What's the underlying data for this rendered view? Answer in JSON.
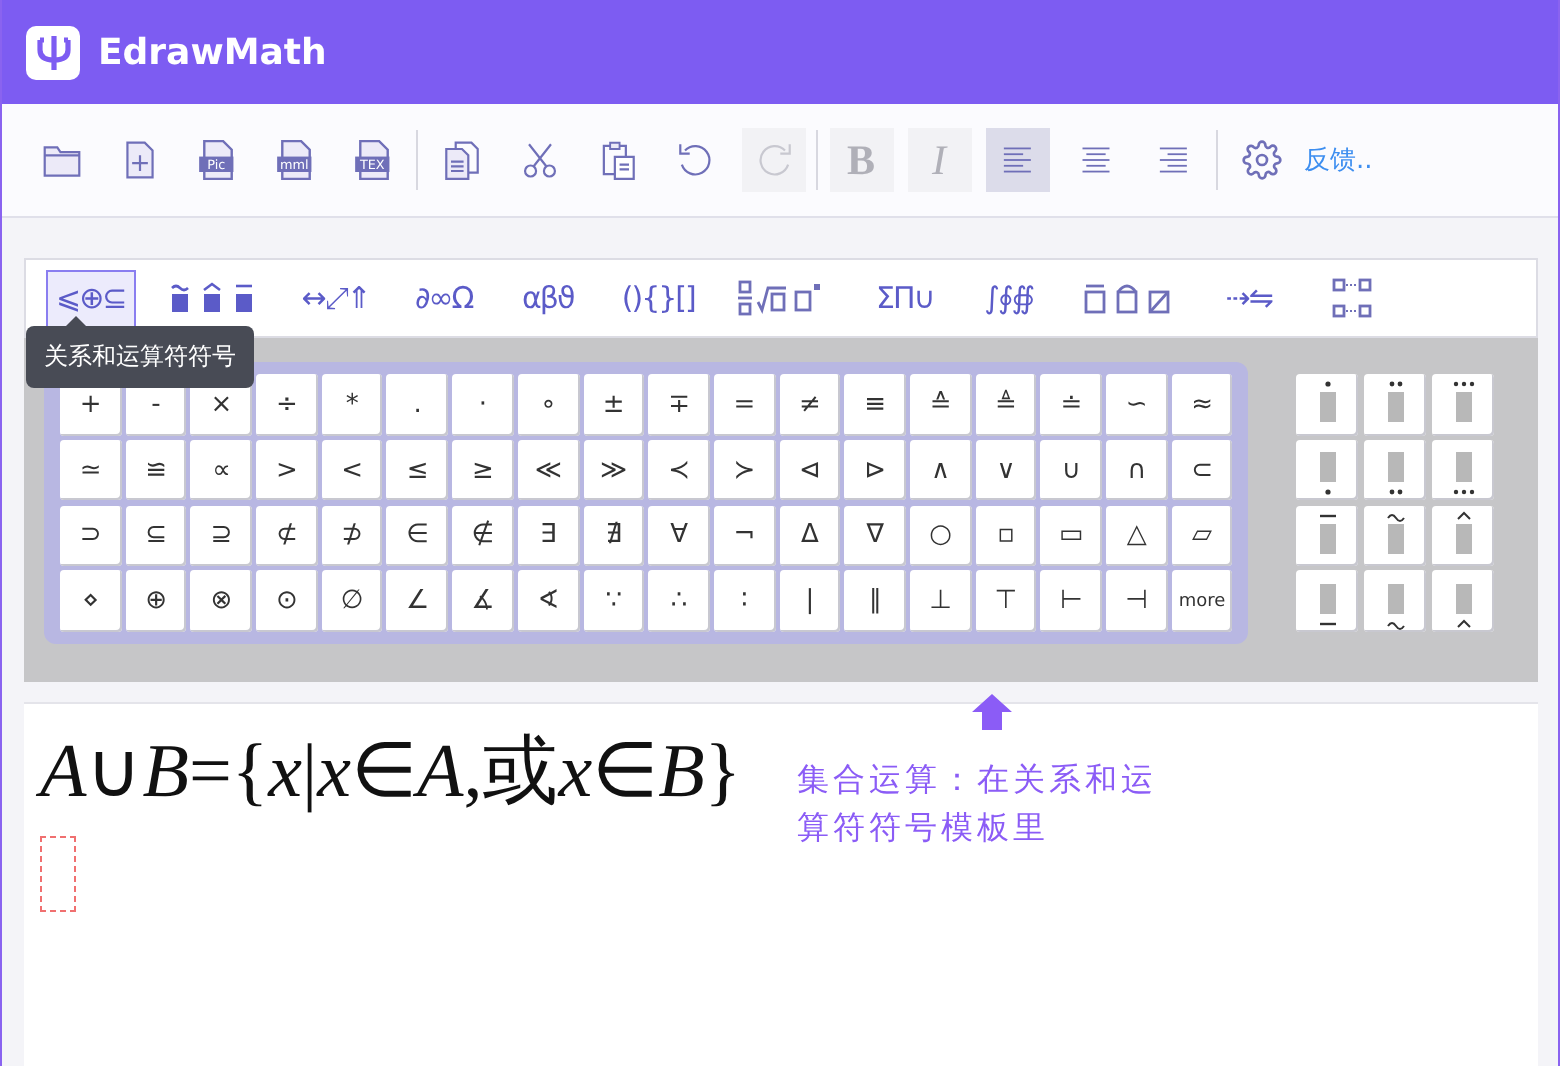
{
  "app": {
    "title": "EdrawMath"
  },
  "toolbar": {
    "file_icons": [
      {
        "kind": "open"
      },
      {
        "kind": "new"
      },
      {
        "kind": "file",
        "label": "Pic"
      },
      {
        "kind": "file",
        "label": "mml"
      },
      {
        "kind": "file",
        "label": "TEX"
      }
    ],
    "edit_icons": [
      {
        "kind": "copy",
        "disabled": false
      },
      {
        "kind": "cut",
        "disabled": false
      },
      {
        "kind": "paste",
        "disabled": false
      },
      {
        "kind": "undo",
        "disabled": false
      },
      {
        "kind": "redo",
        "disabled": true
      }
    ],
    "format_buttons": [
      {
        "label": "B",
        "kind": "bold",
        "disabled": true
      },
      {
        "label": "I",
        "kind": "italic",
        "disabled": true
      }
    ],
    "align_buttons": [
      {
        "kind": "left",
        "selected": true
      },
      {
        "kind": "center",
        "selected": false
      },
      {
        "kind": "right",
        "selected": false
      }
    ],
    "feedback": "反馈.."
  },
  "template_tabs": [
    {
      "kind": "text",
      "label": "⩽⊕⊆",
      "selected": true
    },
    {
      "kind": "accents",
      "selected": false
    },
    {
      "kind": "text",
      "label": "↔⤢⇑",
      "selected": false
    },
    {
      "kind": "text",
      "label": "∂∞Ω",
      "selected": false
    },
    {
      "kind": "text",
      "label": "αβϑ",
      "selected": false
    },
    {
      "kind": "text",
      "label": "(){}[]",
      "selected": false
    },
    {
      "kind": "fractions",
      "selected": false
    },
    {
      "kind": "text",
      "label": "ΣΠ∪",
      "selected": false
    },
    {
      "kind": "text",
      "label": "∫∮∯",
      "selected": false
    },
    {
      "kind": "boxes",
      "selected": false
    },
    {
      "kind": "text",
      "label": "⇢⇋",
      "selected": false
    },
    {
      "kind": "matrix",
      "selected": false
    }
  ],
  "tooltip": "关系和运算符符号",
  "symbol_keys": [
    [
      "+",
      "-",
      "×",
      "÷",
      "*",
      ".",
      "·",
      "∘",
      "±",
      "∓",
      "=",
      "≠",
      "≡",
      "≙",
      "≜",
      "≐",
      "∽",
      "≈"
    ],
    [
      "≃",
      "≌",
      "∝",
      ">",
      "<",
      "≤",
      "≥",
      "≪",
      "≫",
      "≺",
      "≻",
      "⊲",
      "⊳",
      "∧",
      "∨",
      "∪",
      "∩",
      "⊂"
    ],
    [
      "⊃",
      "⊆",
      "⊇",
      "⊄",
      "⊅",
      "∈",
      "∉",
      "∃",
      "∄",
      "∀",
      "¬",
      "Δ",
      "∇",
      "○",
      "▫",
      "▭",
      "△",
      "▱"
    ],
    [
      "⋄",
      "⊕",
      "⊗",
      "⊙",
      "∅",
      "∠",
      "∡",
      "∢",
      "∵",
      "∴",
      "∶",
      "|",
      "∥",
      "⊥",
      "⊤",
      "⊢",
      "⊣",
      "more"
    ]
  ],
  "editor": {
    "formula": [
      {
        "text": "A",
        "italic": true
      },
      {
        "text": "∪",
        "italic": false
      },
      {
        "text": "B",
        "italic": true
      },
      {
        "text": "={",
        "italic": false
      },
      {
        "text": "x",
        "italic": true
      },
      {
        "text": "|",
        "italic": false
      },
      {
        "text": "x",
        "italic": true
      },
      {
        "text": "∈",
        "italic": false
      },
      {
        "text": "A",
        "italic": true
      },
      {
        "text": ",或",
        "italic": false
      },
      {
        "text": "x",
        "italic": true
      },
      {
        "text": "∈",
        "italic": false
      },
      {
        "text": "B",
        "italic": true
      },
      {
        "text": "}",
        "italic": false
      }
    ],
    "annotation": "集合运算：在关系和运算符符号模板里"
  }
}
